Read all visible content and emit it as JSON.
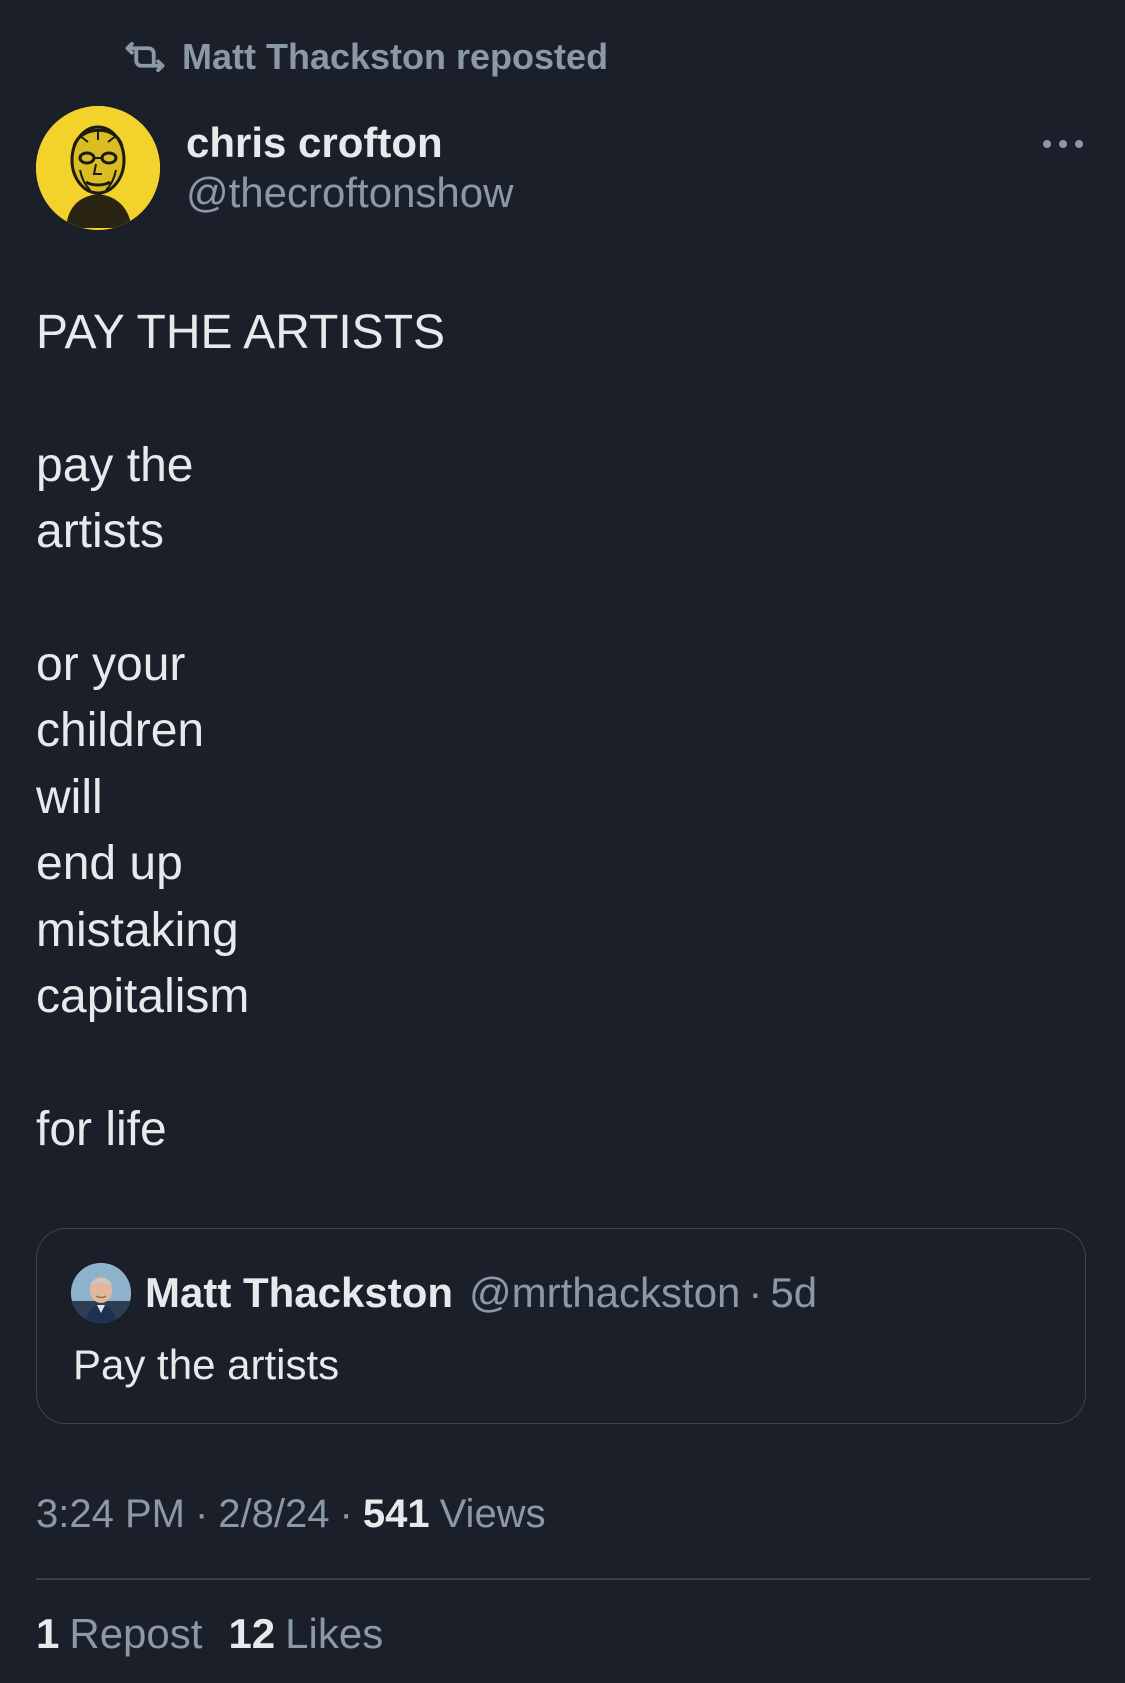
{
  "repost": {
    "text": "Matt Thackston reposted",
    "icon": "repost-icon"
  },
  "author": {
    "name": "chris crofton",
    "handle": "@thecroftonshow",
    "avatar_icon": "avatar"
  },
  "post": {
    "heading": "PAY THE ARTISTS",
    "lines": {
      "l1": "pay the",
      "l2": "artists",
      "l3": "or your",
      "l4": "children",
      "l5": "will",
      "l6": "end up",
      "l7": "mistaking",
      "l8": "capitalism",
      "l9": "for life"
    }
  },
  "quote": {
    "name": "Matt Thackston",
    "handle": "@mrthackston",
    "separator": "·",
    "time": "5d",
    "text": "Pay the artists"
  },
  "meta": {
    "time": "3:24 PM",
    "sep1": "·",
    "date": "2/8/24",
    "sep2": "·",
    "views_count": "541",
    "views_label": "Views"
  },
  "stats": {
    "reposts_count": "1",
    "reposts_label": "Repost",
    "likes_count": "12",
    "likes_label": "Likes"
  },
  "colors": {
    "background": "#1a1f29",
    "primary_text": "#e7e9ea",
    "secondary_text": "#8b98a5",
    "avatar_yellow": "#f3d22b"
  }
}
